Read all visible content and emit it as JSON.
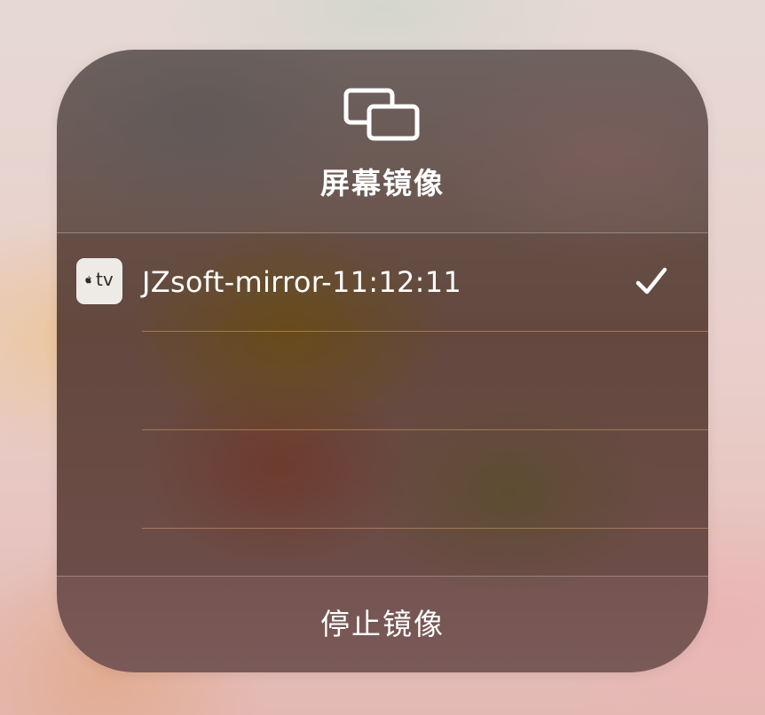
{
  "dialog": {
    "icon": "screen-mirroring-icon",
    "title": "屏幕镜像"
  },
  "devices": [
    {
      "name": "JZsoft-mirror-11:12:11",
      "icon": "apple-tv-icon",
      "icon_text": "tv",
      "selected": true
    }
  ],
  "footer": {
    "stop_label": "停止镜像"
  }
}
